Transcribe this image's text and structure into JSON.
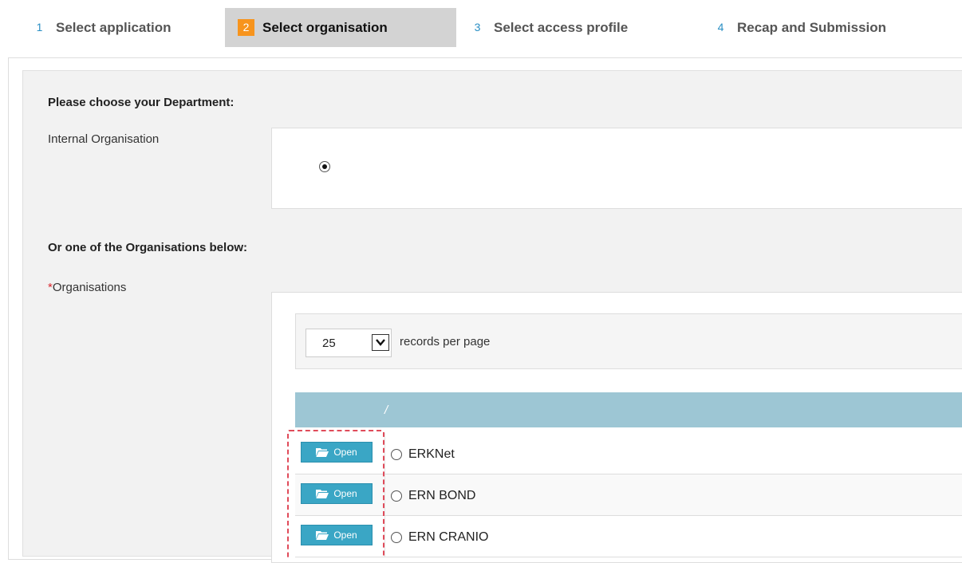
{
  "wizard": {
    "steps": [
      {
        "num": "1",
        "label": "Select application"
      },
      {
        "num": "2",
        "label": "Select organisation"
      },
      {
        "num": "3",
        "label": "Select access profile"
      },
      {
        "num": "4",
        "label": "Recap and Submission"
      }
    ],
    "active_step": 2
  },
  "form": {
    "department_title": "Please choose your Department:",
    "internal_org_label": "Internal Organisation",
    "or_title": "Or one of the Organisations below:",
    "required_mark": "*",
    "organisations_label": "Organisations"
  },
  "records": {
    "per_page_value": "25",
    "per_page_label": "records per page"
  },
  "table": {
    "header_text": "/",
    "open_label": "Open",
    "rows": [
      {
        "name": "ERKNet"
      },
      {
        "name": "ERN BOND"
      },
      {
        "name": "ERN CRANIO"
      }
    ]
  },
  "colors": {
    "active_step_bg": "#d3d3d3",
    "active_step_num": "#f7941d",
    "step_num_text": "#2a8fc4",
    "table_header": "#9dc6d4",
    "open_button": "#3aa6c5",
    "highlight": "#e04b5a",
    "required": "#d9272e"
  },
  "icons": {
    "select_arrow": "chevron-down-icon",
    "open_folder": "folder-open-icon"
  }
}
